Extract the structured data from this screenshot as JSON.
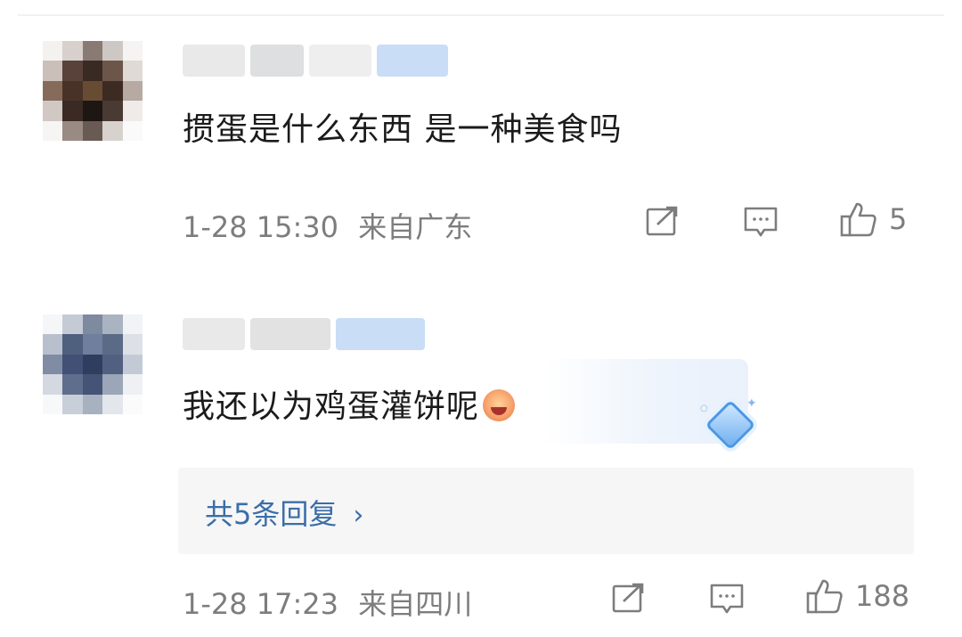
{
  "comments": [
    {
      "text": "掼蛋是什么东西 是一种美食吗",
      "time": "1-28 15:30",
      "location": "来自广东",
      "likes": "5"
    },
    {
      "text": "我还以为鸡蛋灌饼呢",
      "time": "1-28 17:23",
      "location": "来自四川",
      "likes": "188",
      "replies_label": "共5条回复",
      "replies_chevron": "›"
    }
  ],
  "icons": {
    "share": "share-icon",
    "reply": "comment-icon",
    "like": "thumbs-up-icon",
    "emoji": "grinning-emoji-icon",
    "badge": "diamond-badge-icon"
  },
  "colors": {
    "link": "#3b6ea8",
    "meta_text": "#7d7d7d",
    "replies_bg": "#f6f6f6"
  }
}
